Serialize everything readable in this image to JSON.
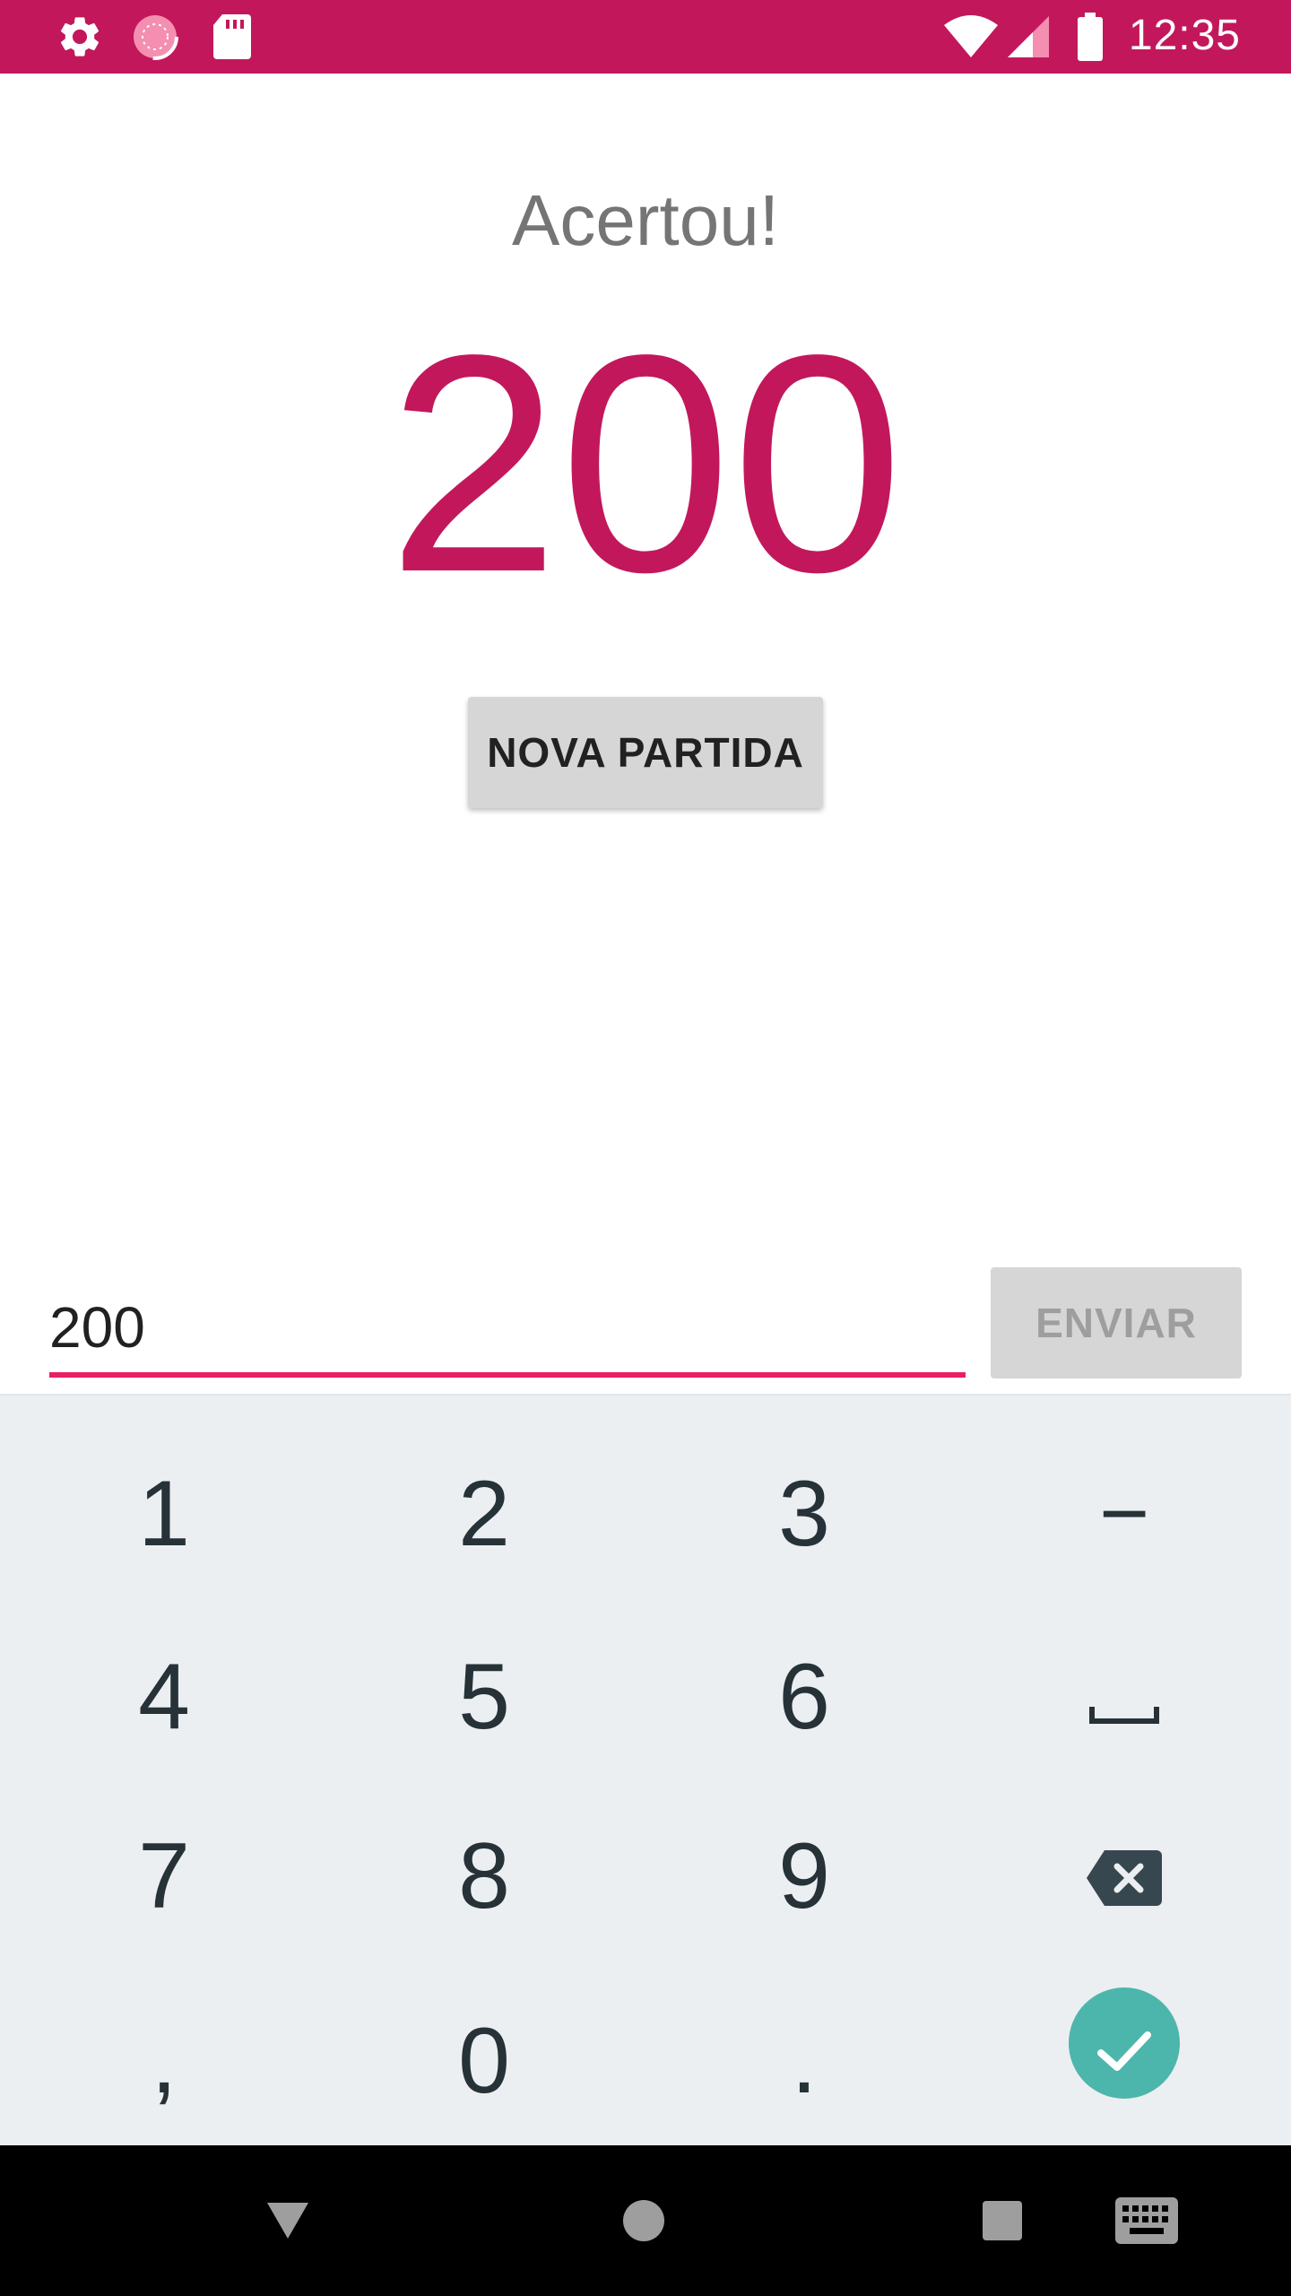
{
  "status_bar": {
    "time": "12:35",
    "icons": [
      "settings-icon",
      "sync-icon",
      "sd-card-icon",
      "wifi-icon",
      "signal-icon",
      "battery-icon"
    ],
    "background": "#C2185B"
  },
  "result": {
    "label": "Acertou!",
    "number": "200",
    "number_color": "#C2185B"
  },
  "buttons": {
    "new_game": "NOVA PARTIDA",
    "send": "ENVIAR"
  },
  "input": {
    "value": "200",
    "underline_color": "#E91E63"
  },
  "keyboard": {
    "keys": [
      "1",
      "2",
      "3",
      "−",
      "4",
      "5",
      "6",
      "space",
      "7",
      "8",
      "9",
      "backspace",
      ",",
      "0",
      ".",
      "enter"
    ],
    "enter_color": "#4DB6AC"
  },
  "nav_bar": {
    "icons": [
      "back-icon",
      "home-icon",
      "recents-icon",
      "keyboard-switch-icon"
    ]
  }
}
